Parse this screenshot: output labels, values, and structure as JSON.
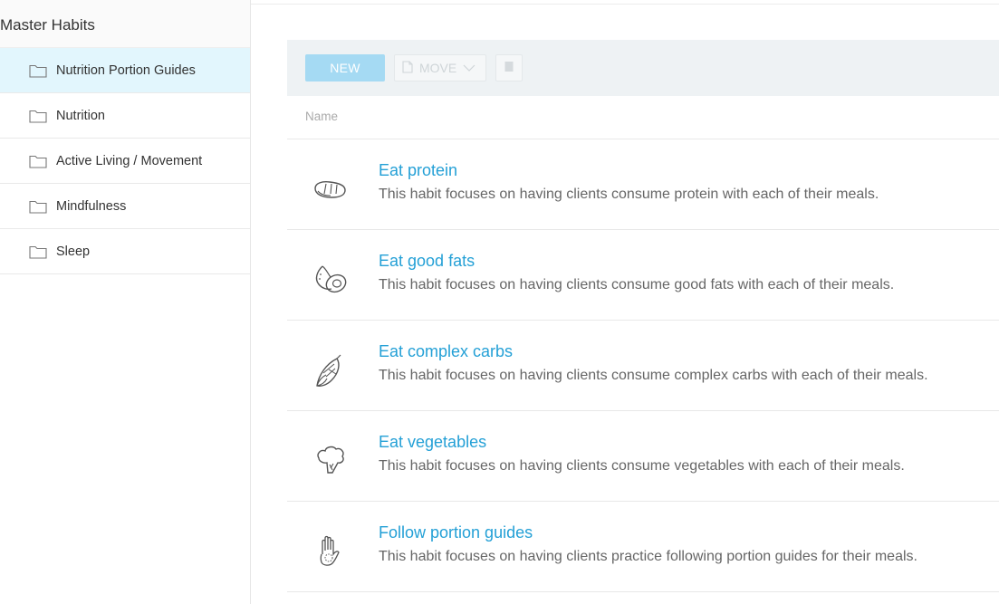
{
  "sidebar": {
    "title": "Master Habits",
    "folders": [
      {
        "label": "Nutrition Portion Guides",
        "active": true
      },
      {
        "label": "Nutrition",
        "active": false
      },
      {
        "label": "Active Living / Movement",
        "active": false
      },
      {
        "label": "Mindfulness",
        "active": false
      },
      {
        "label": "Sleep",
        "active": false
      }
    ]
  },
  "toolbar": {
    "new_label": "NEW",
    "move_label": "MOVE"
  },
  "table": {
    "column_name": "Name"
  },
  "habits": [
    {
      "title": "Eat protein",
      "description": "This habit focuses on having clients consume protein with each of their meals.",
      "icon": "meat-icon"
    },
    {
      "title": "Eat good fats",
      "description": "This habit focuses on having clients consume good fats with each of their meals.",
      "icon": "avocado-icon"
    },
    {
      "title": "Eat complex carbs",
      "description": "This habit focuses on having clients consume complex carbs with each of their meals.",
      "icon": "corn-icon"
    },
    {
      "title": "Eat vegetables",
      "description": "This habit focuses on having clients consume vegetables with each of their meals.",
      "icon": "broccoli-icon"
    },
    {
      "title": "Follow portion guides",
      "description": "This habit focuses on having clients practice following portion guides for their meals.",
      "icon": "hand-icon"
    }
  ],
  "colors": {
    "accent": "#24a0d6",
    "active_folder": "#e2f6fd",
    "new_button": "#a5daf3"
  }
}
